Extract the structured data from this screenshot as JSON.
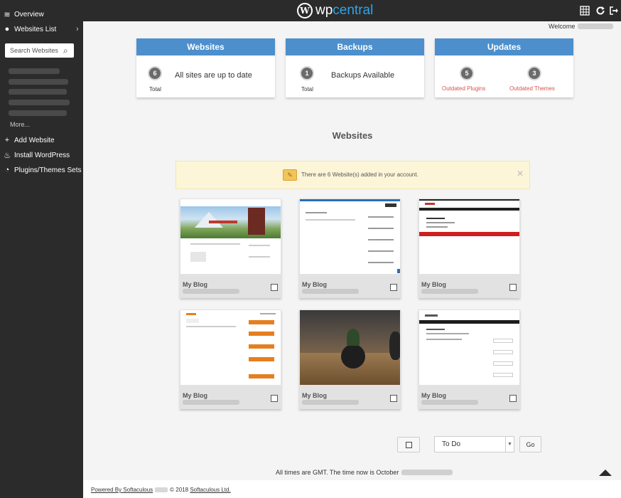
{
  "header": {
    "logo_wp": "wp",
    "logo_central": "central",
    "icons": [
      "network-icon",
      "refresh-icon",
      "logout-icon"
    ],
    "accent": "#2fa4e7"
  },
  "welcome_label": "Welcome",
  "sidebar": {
    "items": [
      {
        "label": "Overview",
        "icon": "layers-icon"
      },
      {
        "label": "Websites List",
        "icon": "globe-icon"
      }
    ],
    "search_placeholder": "Search Websites",
    "more_label": "More...",
    "actions": [
      {
        "label": "Add Website",
        "icon": "plus-icon"
      },
      {
        "label": "Install WordPress",
        "icon": "wordpress-icon"
      },
      {
        "label": "Plugins/Themes Sets",
        "icon": "pie-icon"
      }
    ]
  },
  "cards": {
    "websites": {
      "title": "Websites",
      "count": "6",
      "count_label": "Total",
      "text": "All sites are up to date"
    },
    "backups": {
      "title": "Backups",
      "count": "1",
      "count_label": "Total",
      "text": "Backups Available"
    },
    "updates": {
      "title": "Updates",
      "plugins_count": "5",
      "plugins_label": "Outdated Plugins",
      "themes_count": "3",
      "themes_label": "Outdated Themes"
    }
  },
  "section_title": "Websites",
  "alert_text": "There are 6 Website(s) added in your account.",
  "sites": [
    {
      "name": "My Blog"
    },
    {
      "name": "My Blog"
    },
    {
      "name": "My Blog"
    },
    {
      "name": "My Blog"
    },
    {
      "name": "My Blog"
    },
    {
      "name": "My Blog"
    }
  ],
  "bulk": {
    "action_value": "To Do",
    "go_label": "Go"
  },
  "time_text": "All times are GMT. The time now is October",
  "footer": {
    "powered": "Powered By Softaculous",
    "copyright": "© 2018",
    "company": "Softaculous Ltd."
  },
  "colors": {
    "sidebar": "#2b2b2b",
    "card_header": "#4d8fcc",
    "outdated": "#d9534f",
    "alert_bg": "#fdf5d7"
  }
}
